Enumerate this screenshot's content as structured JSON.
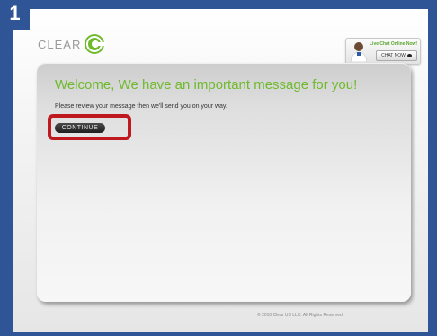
{
  "step_badge": "1",
  "header": {
    "logo_text": "CLEAR",
    "chat": {
      "title": "Live Chat Online Now!",
      "button_label": "CHAT NOW"
    }
  },
  "main": {
    "headline": "Welcome, We have an important message for you!",
    "message": "Please review your message then we'll send you on your way.",
    "continue_label": "CONTINUE"
  },
  "footer": {
    "copyright": "© 2010 Clear US LLC. All Rights Reserved"
  },
  "colors": {
    "brand_green": "#6fba2c",
    "frame_blue": "#2f5596",
    "highlight_red": "#c0181f"
  },
  "icons": [
    "clear-logo-icon",
    "agent-avatar-icon",
    "chat-bubble-icon"
  ]
}
